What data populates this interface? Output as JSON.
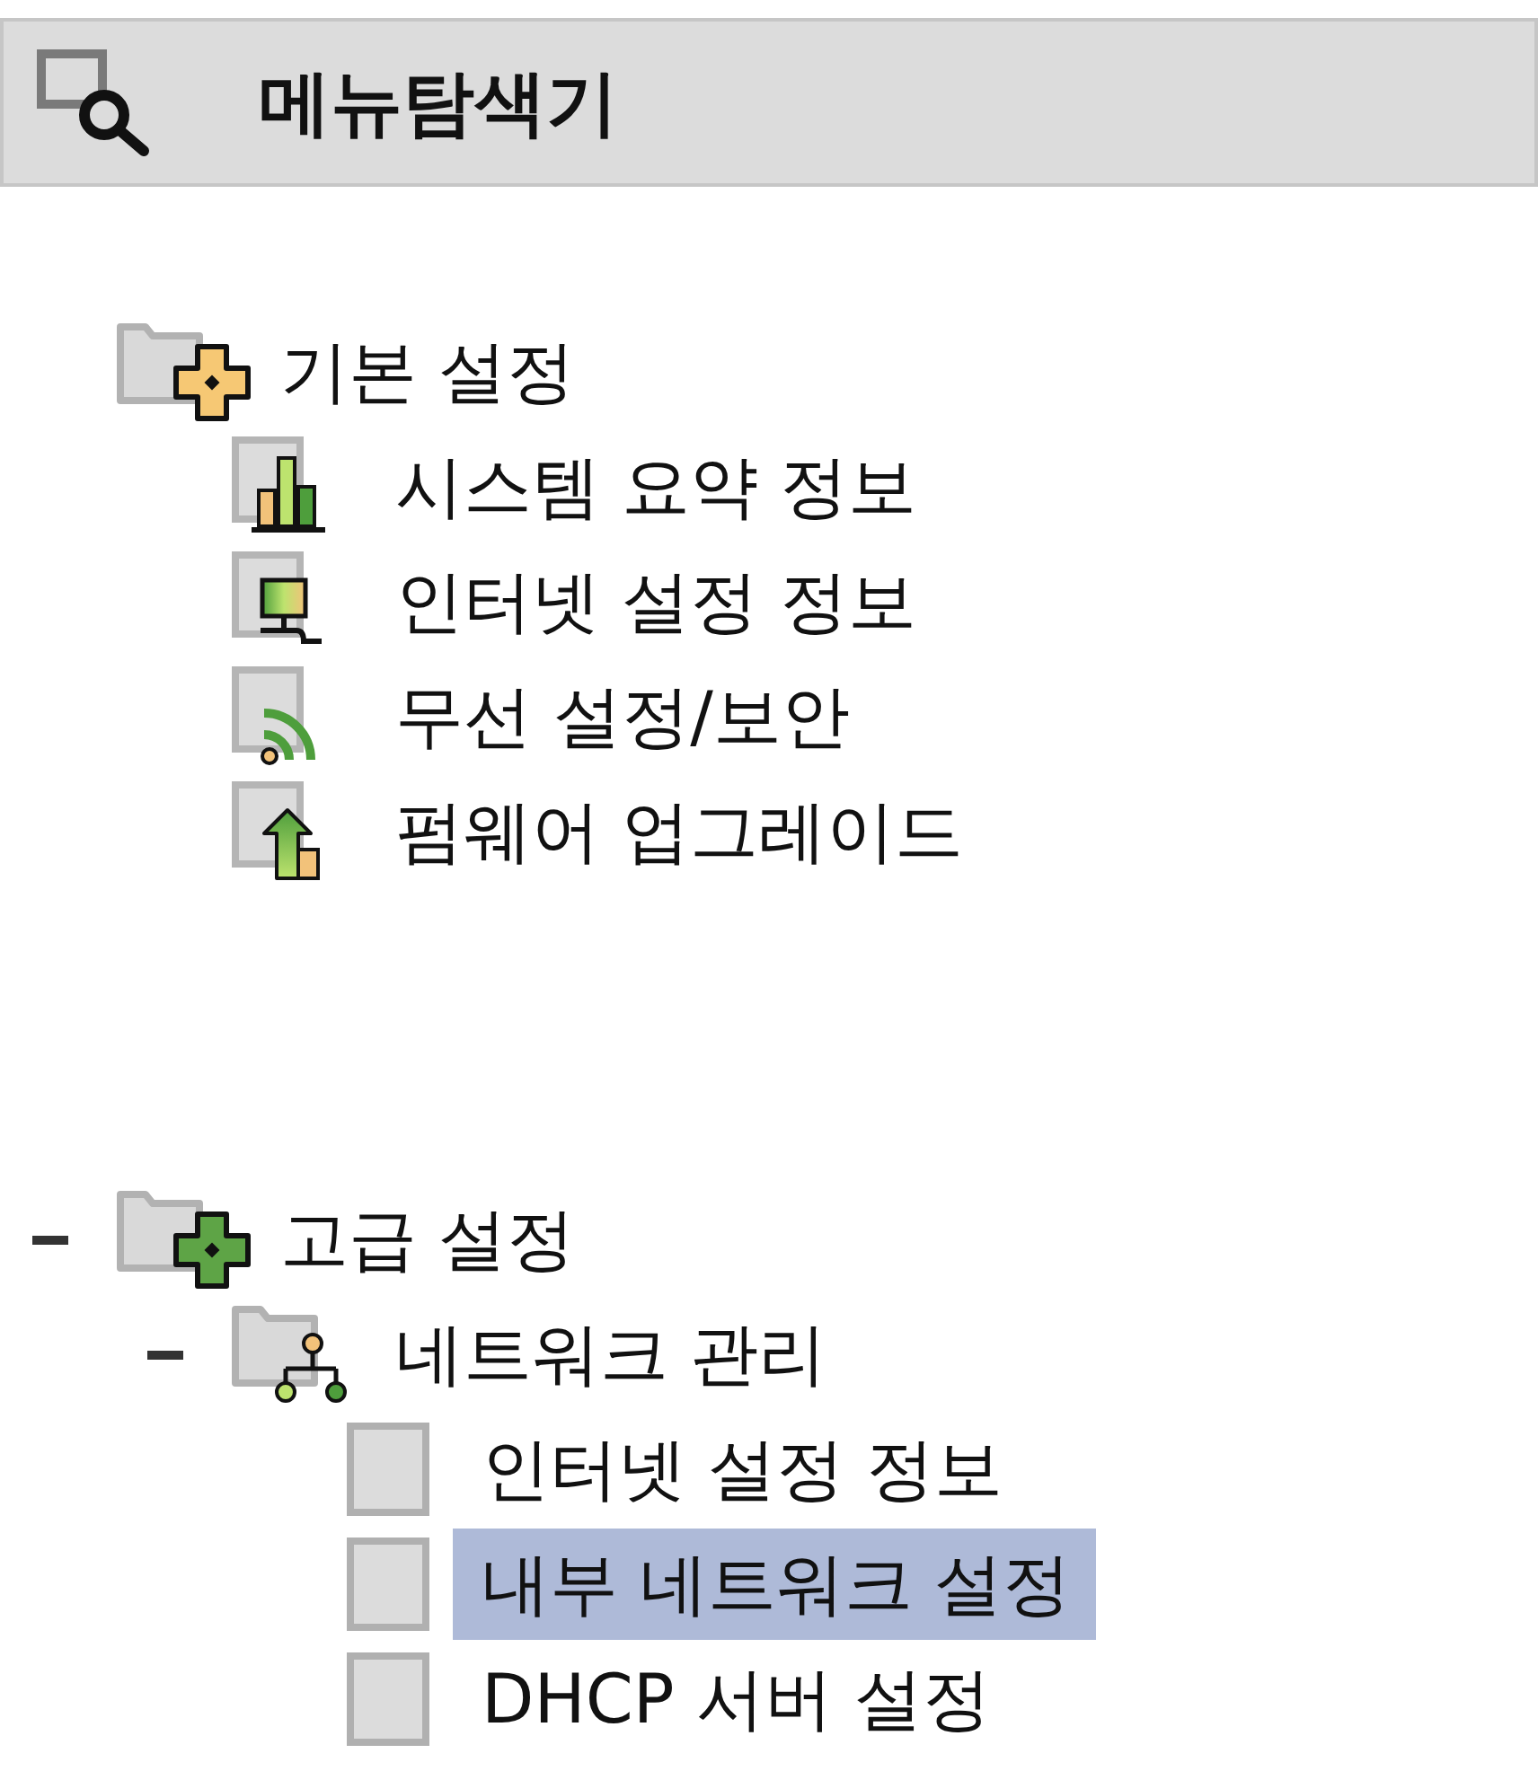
{
  "header": {
    "title": "메뉴탐색기"
  },
  "tree": [
    {
      "label": "기본 설정",
      "kind": "folder",
      "color": "#f6c874",
      "selected": false,
      "children": [
        {
          "label": "시스템 요약 정보",
          "kind": "chart",
          "selected": false
        },
        {
          "label": "인터넷 설정 정보",
          "kind": "monitor",
          "selected": false
        },
        {
          "label": "무선 설정/보안",
          "kind": "wireless",
          "selected": false
        },
        {
          "label": "펌웨어 업그레이드",
          "kind": "upgrade",
          "selected": false
        }
      ]
    },
    {
      "label": "고급 설정",
      "kind": "folder",
      "color": "#5ea446",
      "expanded": true,
      "selected": false,
      "children": [
        {
          "label": "네트워크 관리",
          "kind": "network",
          "expanded": true,
          "selected": false,
          "children": [
            {
              "label": "인터넷 설정 정보",
              "kind": "page",
              "selected": false
            },
            {
              "label": "내부 네트워크 설정",
              "kind": "page",
              "selected": true
            },
            {
              "label": "DHCP 서버 설정",
              "kind": "page",
              "selected": false
            }
          ]
        }
      ]
    }
  ]
}
